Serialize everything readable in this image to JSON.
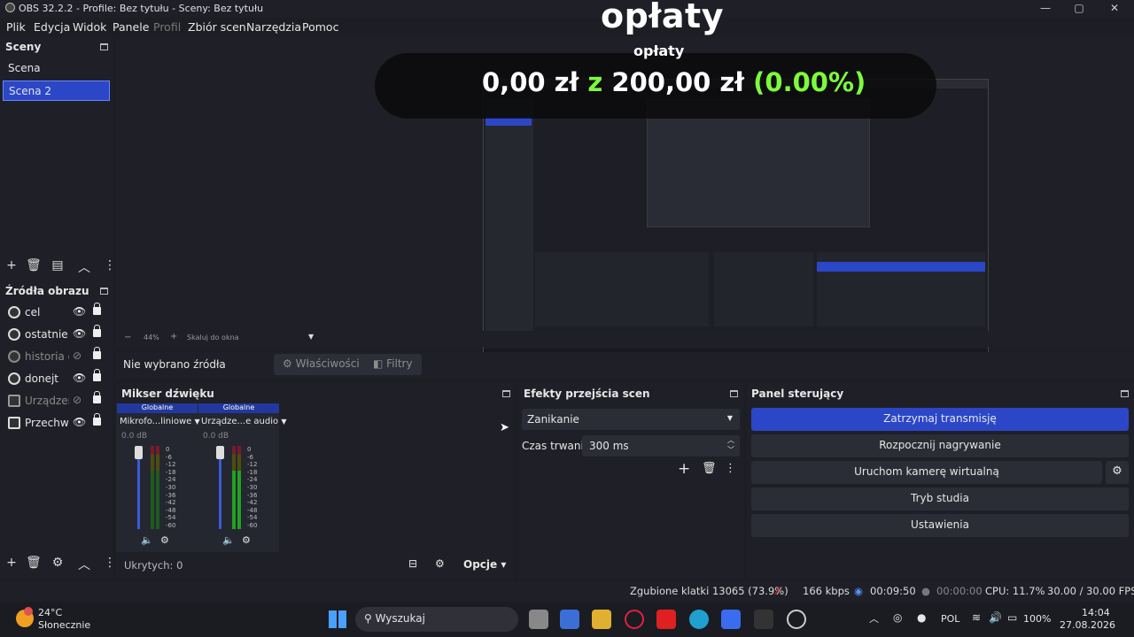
{
  "window": {
    "title": "OBS 32.2.2 - Profile: Bez tytułu - Sceny: Bez tytułu"
  },
  "menu": [
    "Plik",
    "Edycja",
    "Widok",
    "Panele",
    "Profil",
    "Zbiór scen",
    "Narzędzia",
    "Pomoc"
  ],
  "overlay": {
    "label": "opłaty",
    "amount_text": "0,00 zł",
    "separator": "z",
    "goal_text": "200,00 zł",
    "percent_text": "(0.00%)",
    "progress": 0.0
  },
  "scenes": {
    "header": "Sceny",
    "items": [
      "Scena",
      "Scena 2"
    ],
    "selected_index": 1
  },
  "sources": {
    "header": "Źródła obrazu",
    "items": [
      {
        "name": "cel",
        "visible": true
      },
      {
        "name": "ostatnie",
        "visible": true
      },
      {
        "name": "historia de",
        "visible": false
      },
      {
        "name": "donejt",
        "visible": true
      },
      {
        "name": "Urządzeni",
        "visible": false
      },
      {
        "name": "Przechwy",
        "visible": true
      }
    ]
  },
  "preview": {
    "zoom": "44%",
    "scale_label": "Skaluj do okna"
  },
  "source_toolbar": {
    "no_source": "Nie wybrano źródła",
    "properties": "Właściwości",
    "filters": "Filtry"
  },
  "mixer": {
    "header": "Mikser dźwięku",
    "channels": [
      {
        "scope": "Globalne",
        "name": "Mikrofo...liniowe",
        "db": "0.0 dB"
      },
      {
        "scope": "Globalne",
        "name": "Urządze...e audio",
        "db": "0.0 dB"
      }
    ],
    "scale": [
      "0",
      "-6",
      "-12",
      "-18",
      "-24",
      "-30",
      "-36",
      "-42",
      "-48",
      "-54",
      "-60"
    ],
    "hidden": "Ukrytych: 0",
    "options": "Opcje"
  },
  "transitions": {
    "header": "Efekty przejścia scen",
    "selected": "Zanikanie",
    "duration_label": "Czas trwania",
    "duration_value": "300 ms"
  },
  "controls": {
    "header": "Panel sterujący",
    "buttons": [
      "Zatrzymaj transmisję",
      "Rozpocznij nagrywanie",
      "Uruchom kamerę wirtualną",
      "Tryb studia",
      "Ustawienia"
    ]
  },
  "status": {
    "dropped": "Zgubione klatki 13065 (73.9%)",
    "bitrate": "166 kbps",
    "stream_time": "00:09:50",
    "rec_time": "00:00:00",
    "cpu": "CPU: 11.7%",
    "fps": "30.00 / 30.00 FPS"
  },
  "taskbar": {
    "weather_temp": "24°C",
    "weather_desc": "Słonecznie",
    "search": "Wyszukaj",
    "lang": "POL",
    "battery": "100%",
    "time": "14:04",
    "date": "27.08.2026"
  },
  "colors": {
    "accent": "#2b47c8",
    "green_text": "#7cfc3c",
    "bg": "#1f2027"
  }
}
